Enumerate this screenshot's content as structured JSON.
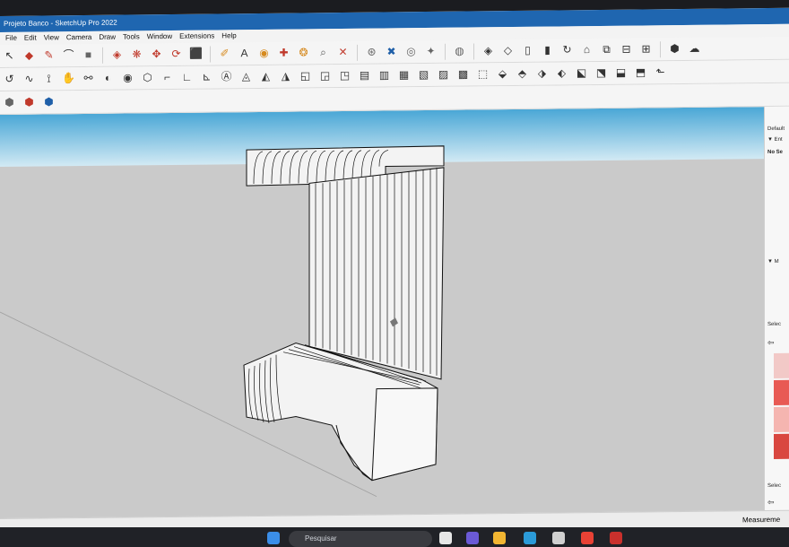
{
  "window": {
    "title": "Projeto Banco - SketchUp Pro 2022"
  },
  "menu": [
    "File",
    "Edit",
    "View",
    "Camera",
    "Draw",
    "Tools",
    "Window",
    "Extensions",
    "Help"
  ],
  "panel": {
    "default_tray": "Default",
    "entity_info": "▼ Ent",
    "no_selection": "No Se",
    "materials": "▼ M",
    "select_label": "Selec",
    "select_label_2": "Selec",
    "swatches": [
      "#f2c9c7",
      "#e85a54",
      "#f5b5b0",
      "#d94740"
    ]
  },
  "statusbar": {
    "measurements_label": "Measureme"
  },
  "taskbar": {
    "search_placeholder": "Pesquisar"
  }
}
